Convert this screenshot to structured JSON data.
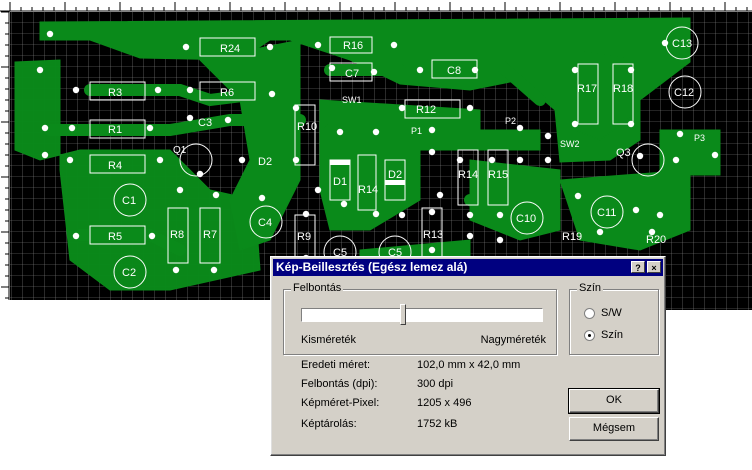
{
  "pcb": {
    "labels": {
      "r24": "R24",
      "r16": "R16",
      "c7": "C7",
      "c8": "C8",
      "c13": "C13",
      "r3": "R3",
      "r6": "R6",
      "sw1": "SW1",
      "r12": "R12",
      "r17": "R17",
      "r18": "R18",
      "c12": "C12",
      "r1": "R1",
      "c3": "C3",
      "r10": "R10",
      "p1": "P1",
      "p2": "P2",
      "sw2": "SW2",
      "p3": "P3",
      "q1": "Q1",
      "r4": "R4",
      "d2a": "D2",
      "d1": "D1",
      "d2b": "D2",
      "r14a": "R14",
      "r14b": "R14",
      "r15": "R15",
      "q3": "Q3",
      "c1": "C1",
      "c4": "C4",
      "c10": "C10",
      "c11": "C11",
      "r8": "R8",
      "r7": "R7",
      "r5": "R5",
      "r9": "R9",
      "r13": "R13",
      "r19": "R19",
      "r20": "R20",
      "c2": "C2",
      "c5a": "C5",
      "c5b": "C5"
    }
  },
  "dialog": {
    "title": "Kép-Beillesztés (Egész lemez alá)",
    "help_button": "?",
    "close_button": "×",
    "resolution_group": {
      "label": "Felbontás",
      "slider_value_fraction": 0.42,
      "min_label": "Kisméreték",
      "max_label": "Nagyméreték"
    },
    "info": [
      {
        "label": "Eredeti méret:",
        "value": "102,0 mm x 42,0 mm"
      },
      {
        "label": "Felbontás (dpi):",
        "value": "300 dpi"
      },
      {
        "label": "Képméret-Pixel:",
        "value": "1205 x 496"
      },
      {
        "label": "Képtárolás:",
        "value": "1752 kB"
      }
    ],
    "color_group": {
      "label": "Szín",
      "options": [
        {
          "label": "S/W",
          "selected": false
        },
        {
          "label": "Szín",
          "selected": true
        }
      ]
    },
    "ok_button": "OK",
    "cancel_button": "Mégsem"
  }
}
